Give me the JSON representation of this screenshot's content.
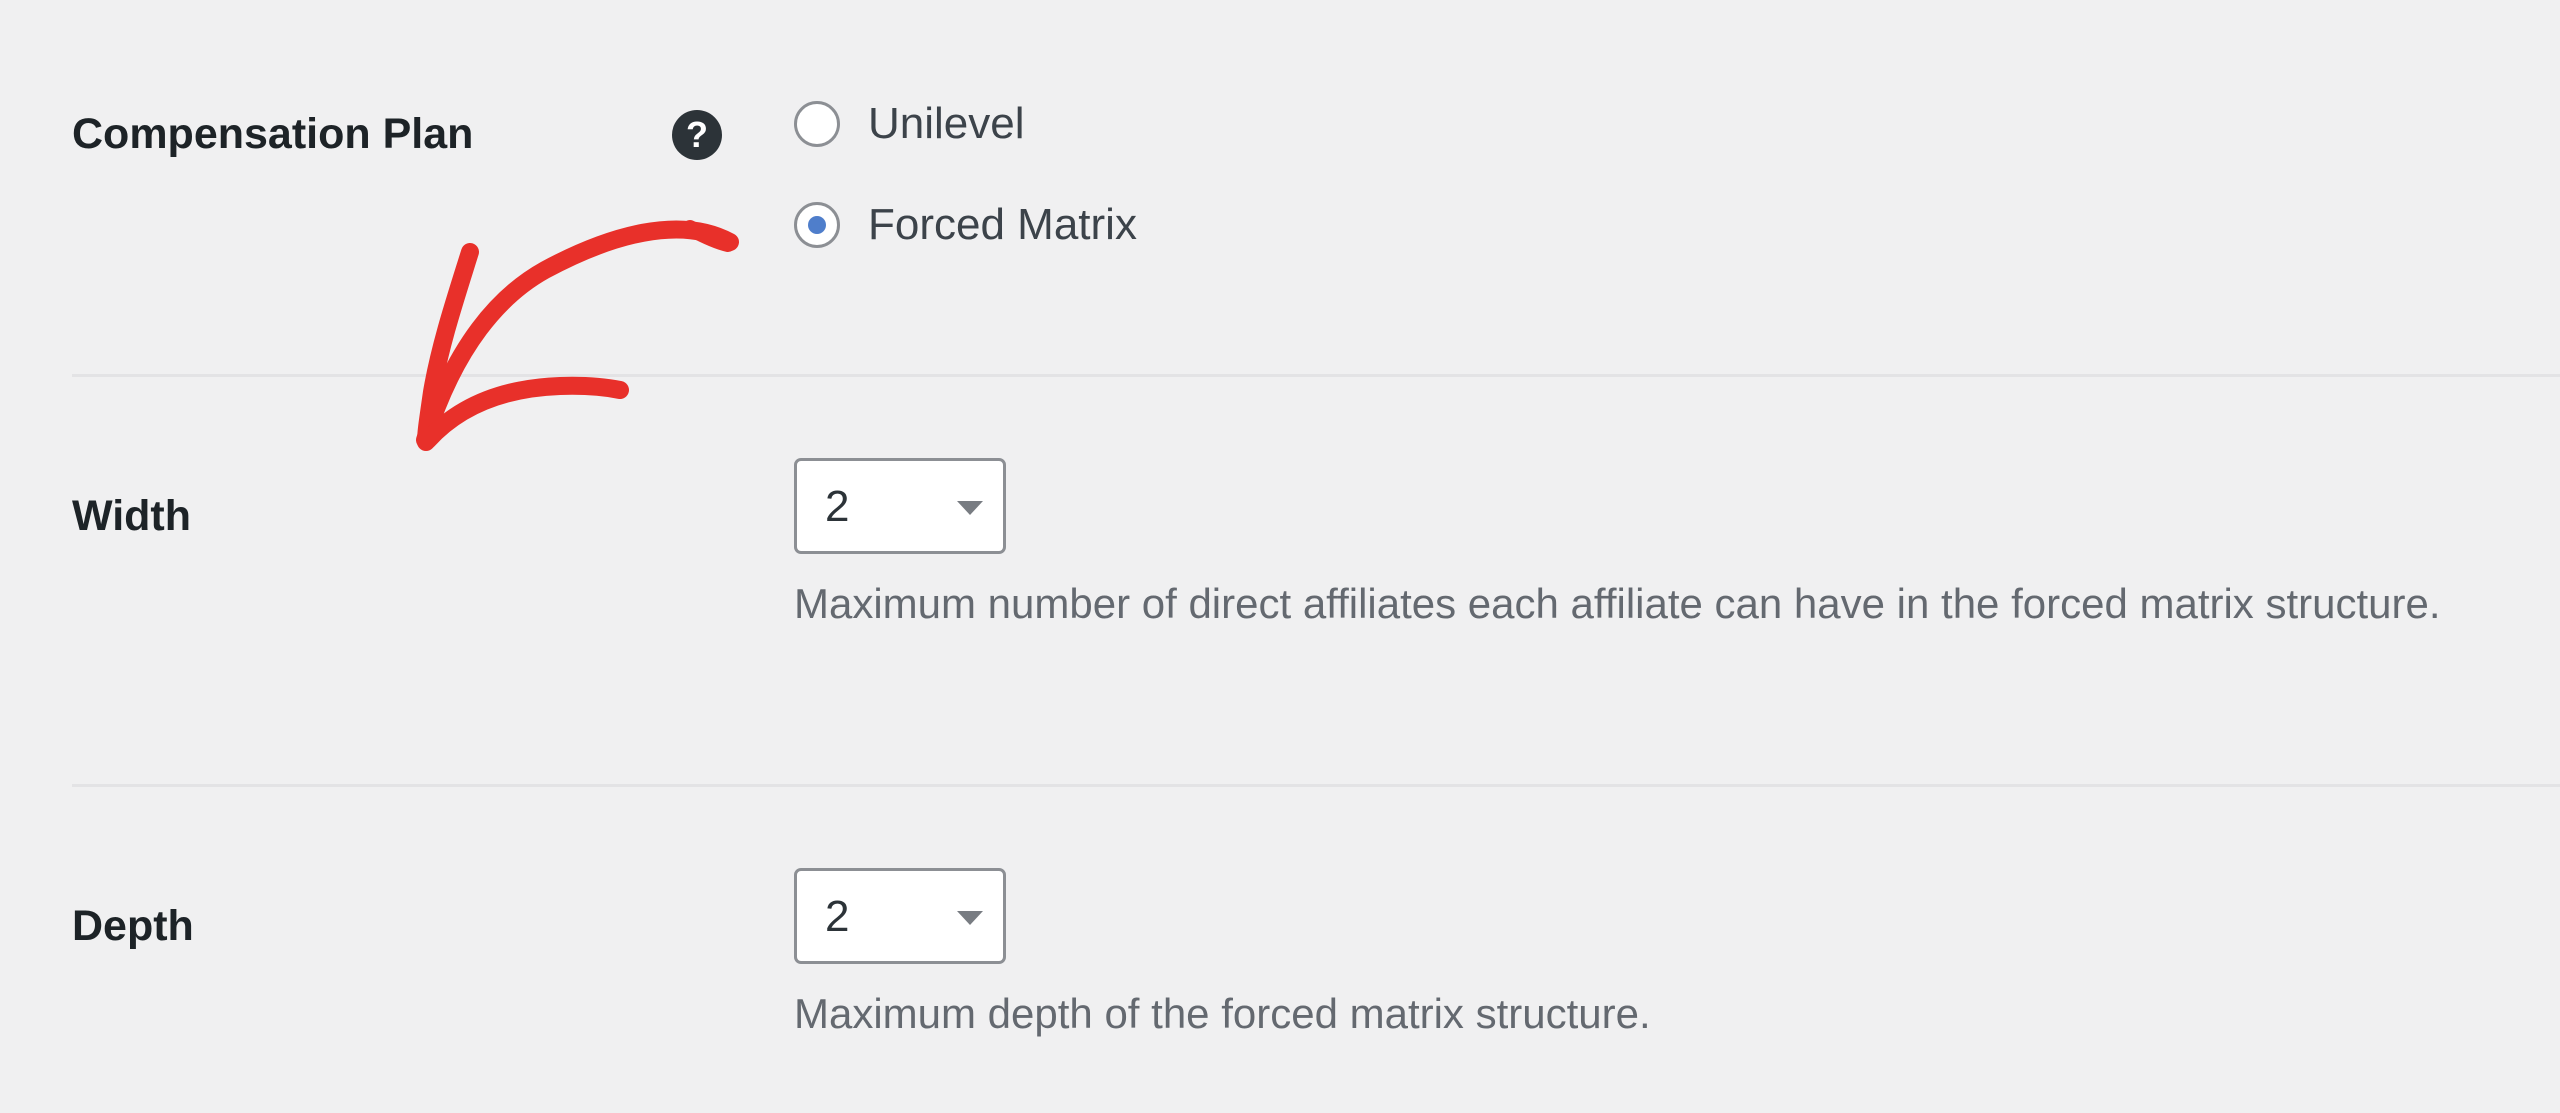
{
  "settings": {
    "compensation_plan": {
      "label": "Compensation Plan",
      "help_icon": "question-mark-icon",
      "help_glyph": "?",
      "options": [
        {
          "label": "Unilevel",
          "selected": false
        },
        {
          "label": "Forced Matrix",
          "selected": true
        }
      ]
    },
    "width": {
      "label": "Width",
      "value": "2",
      "description": "Maximum number of direct affiliates each affiliate can have in the forced matrix structure."
    },
    "depth": {
      "label": "Depth",
      "value": "2",
      "description": "Maximum depth of the forced matrix structure."
    }
  },
  "colors": {
    "background": "#f0f0f1",
    "label_text": "#1d2327",
    "description_text": "#646970",
    "radio_selected": "#4f7ecb",
    "annotation_arrow": "#e8302a"
  }
}
